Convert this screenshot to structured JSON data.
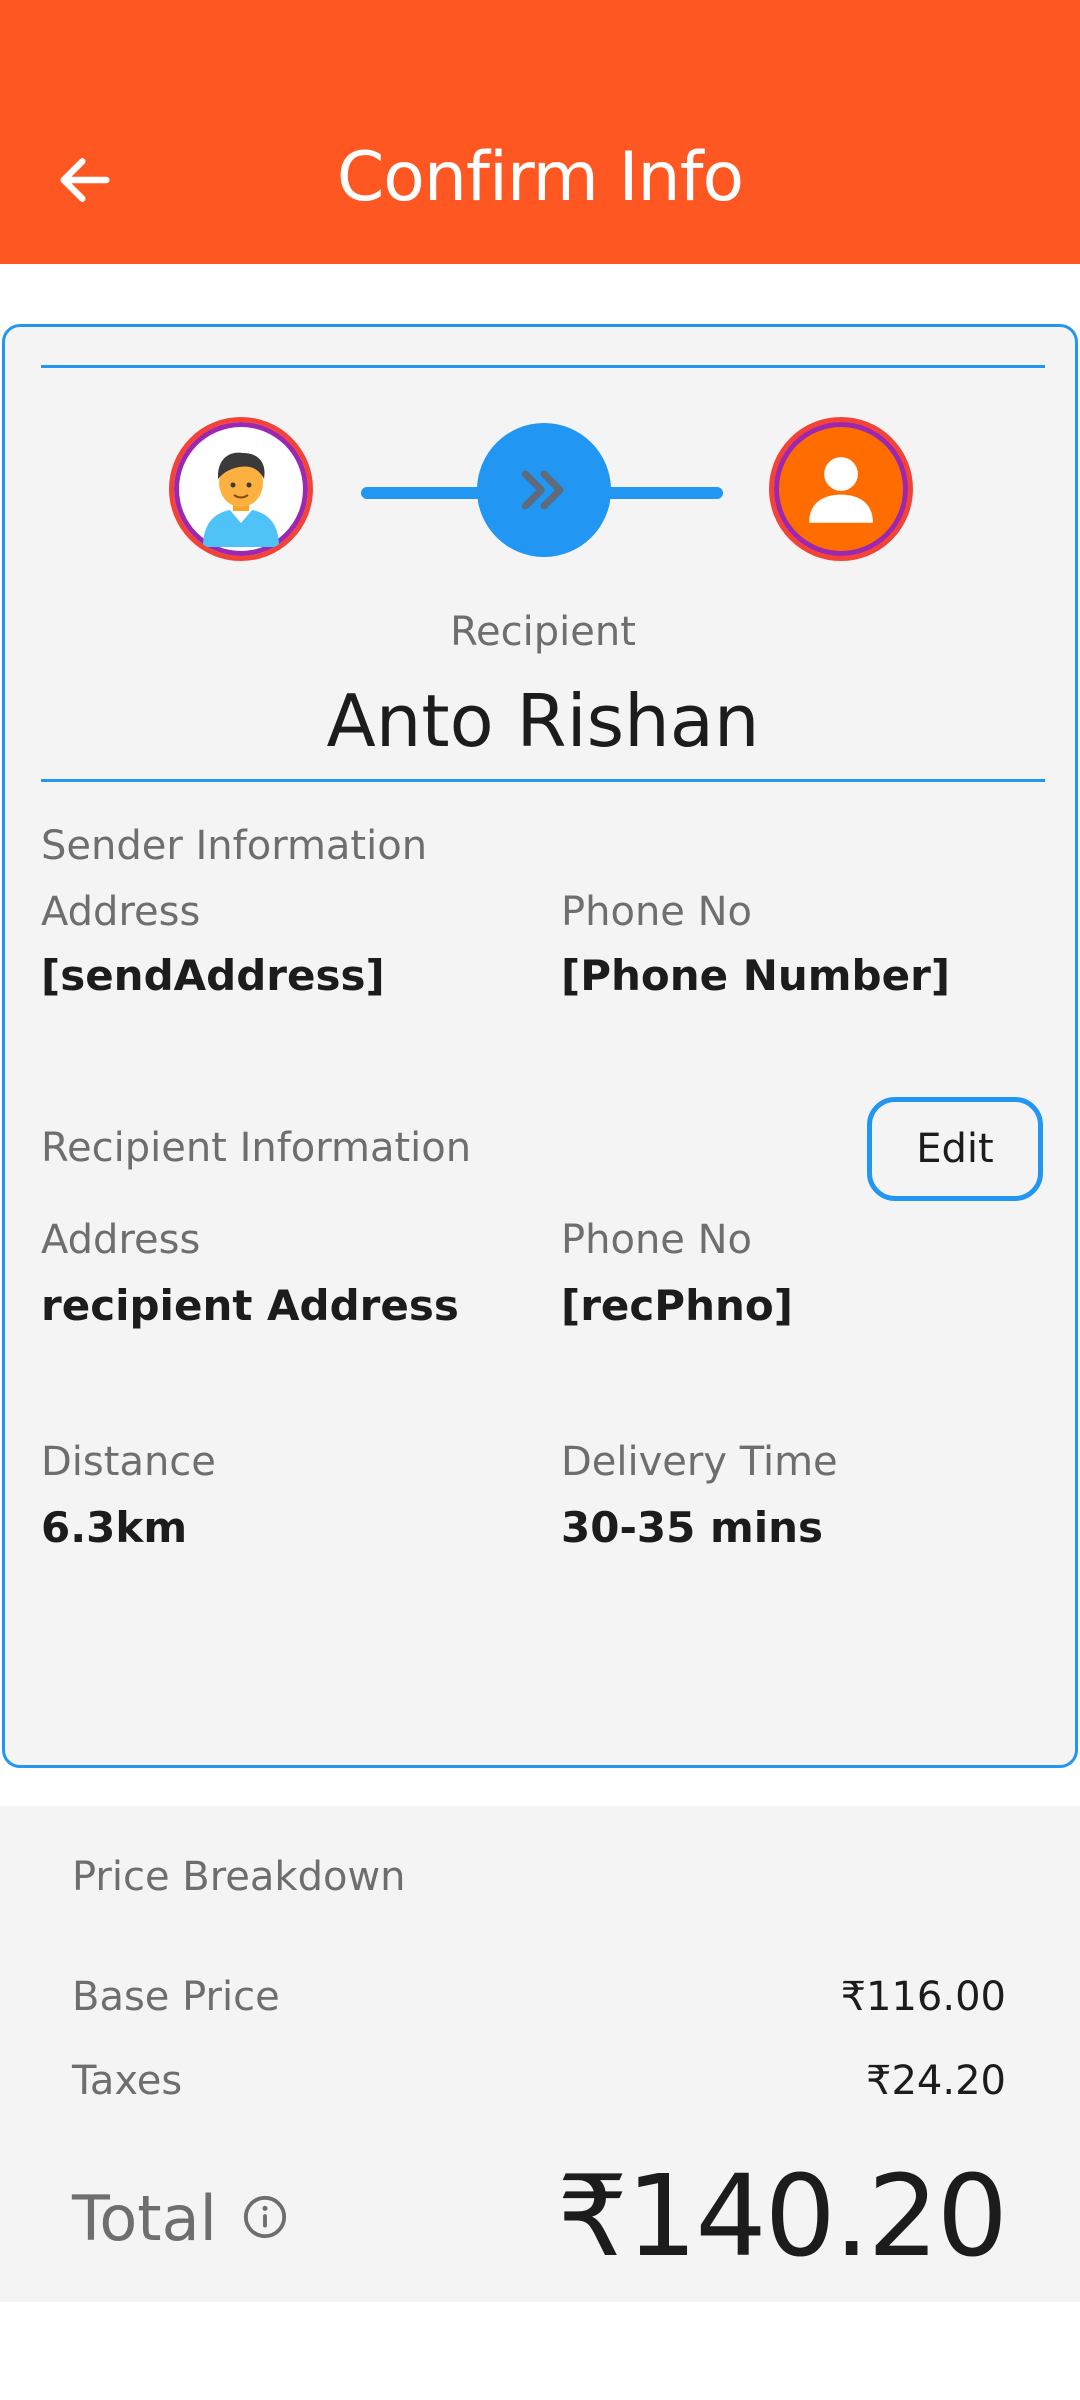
{
  "appbar": {
    "title": "Confirm Info",
    "background": "#ff5722"
  },
  "icons": {
    "back": "arrow-left-icon",
    "sender_avatar": "boy-avatar-icon",
    "recipient_avatar": "person-icon",
    "transfer": "double-chevron-right-icon",
    "info": "info-icon"
  },
  "recipient": {
    "label": "Recipient",
    "name": "Anto Rishan"
  },
  "sender_info": {
    "title": "Sender Information",
    "address_label": "Address",
    "address_value": "[sendAddress]",
    "phone_label": "Phone No",
    "phone_value": "[Phone Number]"
  },
  "recipient_info": {
    "title": "Recipient Information",
    "edit_label": "Edit",
    "address_label": "Address",
    "address_value": "recipient Address",
    "phone_label": "Phone No",
    "phone_value": "[recPhno]"
  },
  "trip": {
    "distance_label": "Distance",
    "distance_value": "6.3km",
    "time_label": "Delivery Time",
    "time_value": "30-35 mins"
  },
  "price": {
    "title": "Price Breakdown",
    "base_label": "Base Price",
    "base_value": "₹116.00",
    "taxes_label": "Taxes",
    "taxes_value": "₹24.20",
    "total_label": "Total",
    "total_value": "₹140.20"
  },
  "colors": {
    "accent": "#2196f3",
    "primary": "#ff5722"
  }
}
